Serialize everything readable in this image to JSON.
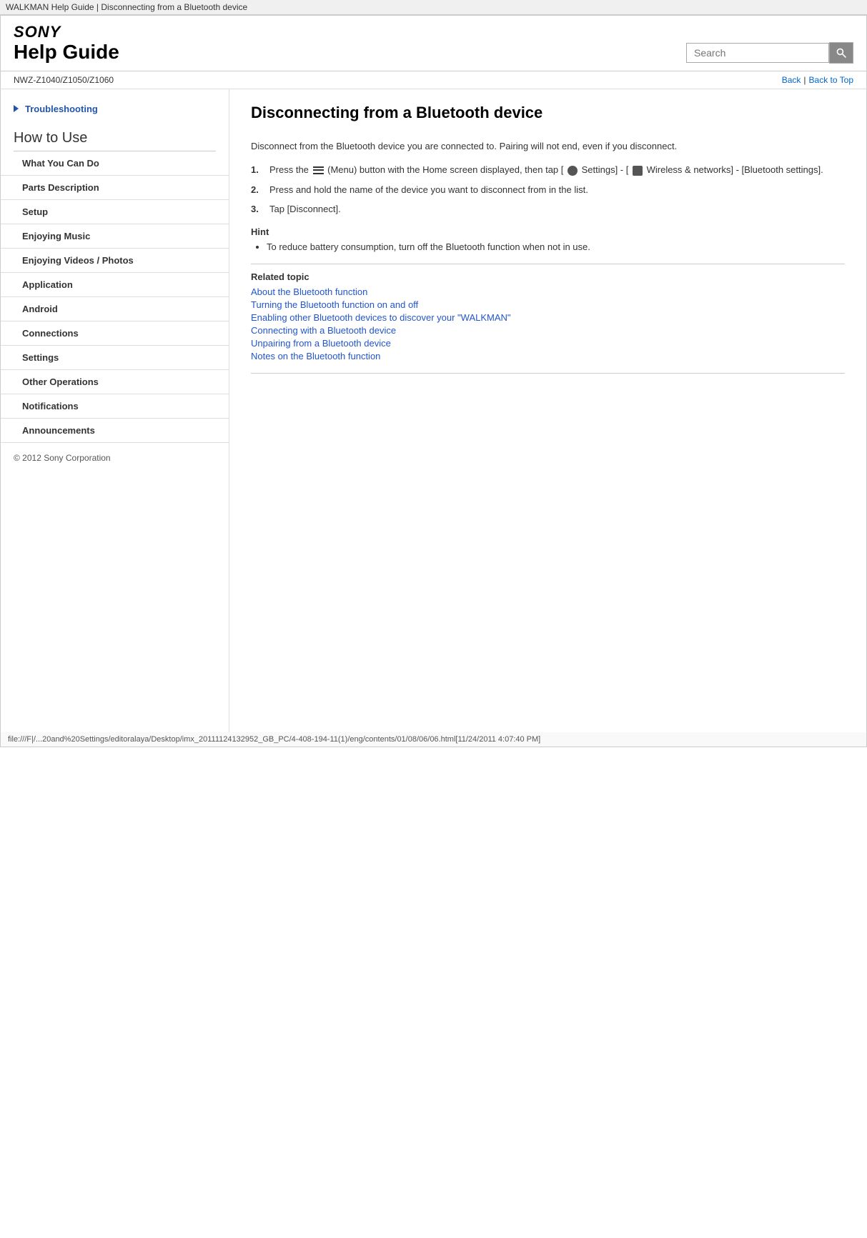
{
  "browser_title": "WALKMAN Help Guide | Disconnecting from a Bluetooth device",
  "header": {
    "sony_logo": "SONY",
    "help_guide_title": "Help Guide",
    "search_placeholder": "Search",
    "search_btn_label": "Go"
  },
  "sub_header": {
    "model": "NWZ-Z1040/Z1050/Z1060",
    "back_link": "Back",
    "back_to_top_link": "Back to Top",
    "separator": "|"
  },
  "sidebar": {
    "troubleshooting_label": "Troubleshooting",
    "how_to_use_label": "How to Use",
    "items": [
      {
        "label": "What You Can Do"
      },
      {
        "label": "Parts Description"
      },
      {
        "label": "Setup"
      },
      {
        "label": "Enjoying Music"
      },
      {
        "label": "Enjoying Videos / Photos"
      },
      {
        "label": "Application"
      },
      {
        "label": "Android"
      },
      {
        "label": "Connections"
      },
      {
        "label": "Settings"
      },
      {
        "label": "Other Operations"
      },
      {
        "label": "Notifications"
      },
      {
        "label": "Announcements"
      }
    ]
  },
  "content": {
    "title": "Disconnecting from a Bluetooth device",
    "intro": "Disconnect from the Bluetooth device you are connected to. Pairing will not end, even if you disconnect.",
    "steps": [
      {
        "num": "1.",
        "text": "Press the  (Menu) button with the Home screen displayed, then tap [  Settings] - [  Wireless & networks] - [Bluetooth settings]."
      },
      {
        "num": "2.",
        "text": "Press and hold the name of the device you want to disconnect from in the list."
      },
      {
        "num": "3.",
        "text": "Tap [Disconnect]."
      }
    ],
    "hint": {
      "title": "Hint",
      "items": [
        "To reduce battery consumption, turn off the Bluetooth function when not in use."
      ]
    },
    "related_topic": {
      "title": "Related topic",
      "links": [
        "About the Bluetooth function",
        "Turning the Bluetooth function on and off",
        "Enabling other Bluetooth devices to discover your \"WALKMAN\"",
        "Connecting with a Bluetooth device",
        "Unpairing from a Bluetooth device",
        "Notes on the Bluetooth function"
      ]
    }
  },
  "copyright": "© 2012 Sony Corporation",
  "footer_url": "file:///F|/...20and%20Settings/editoralaya/Desktop/imx_20111124132952_GB_PC/4-408-194-11(1)/eng/contents/01/08/06/06.html[11/24/2011 4:07:40 PM]"
}
